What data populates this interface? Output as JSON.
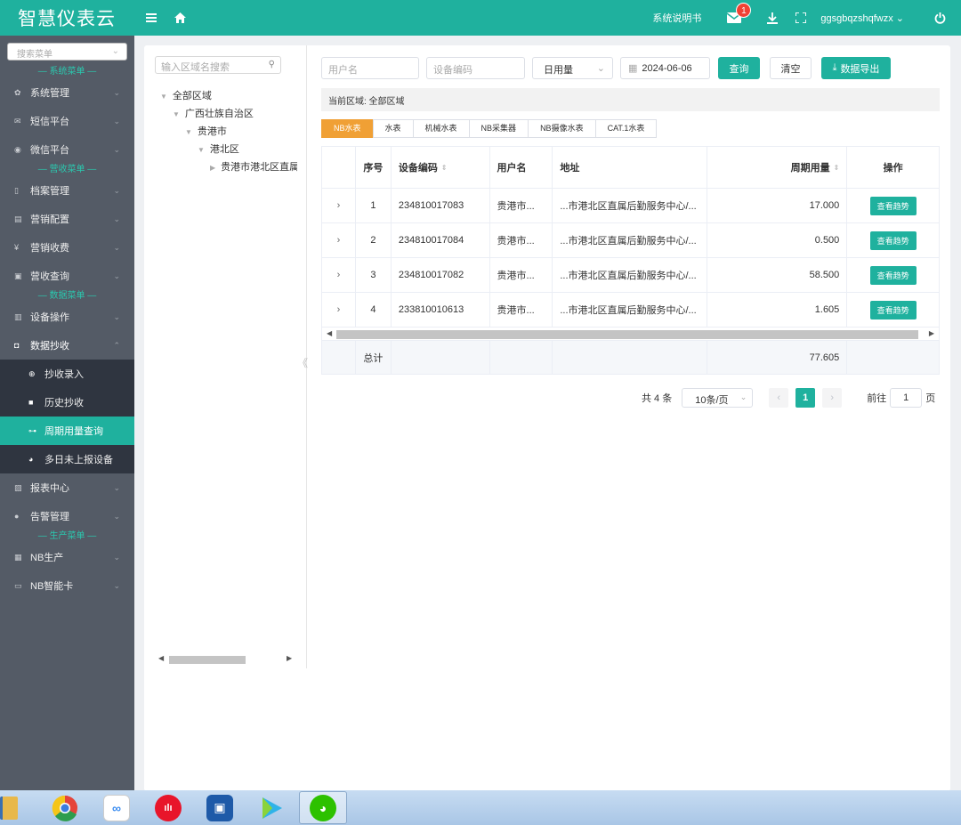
{
  "header": {
    "brand": "智慧仪表云",
    "manual": "系统说明书",
    "mail_badge": "1",
    "username": "ggsgbqzshqfwzx",
    "icons": [
      "menu-icon",
      "home-icon",
      "mail-icon",
      "download-icon",
      "fullscreen-icon",
      "power-icon"
    ]
  },
  "sidebar": {
    "search_placeholder": "搜索菜单",
    "sections": [
      "— 系统菜单 —",
      "— 营收菜单 —",
      "— 数据菜单 —",
      "— 生产菜单 —"
    ],
    "items": {
      "system": "系统管理",
      "sms": "短信平台",
      "wechat": "微信平台",
      "archive": "档案管理",
      "sales_config": "营销配置",
      "sales_fee": "营销收费",
      "revenue_query": "营收查询",
      "device_op": "设备操作",
      "meter_reading": "数据抄收",
      "reading_entry": "抄收录入",
      "history_reading": "历史抄收",
      "period_usage": "周期用量查询",
      "no_report": "多日未上报设备",
      "report": "报表中心",
      "alarm": "告警管理",
      "nb_prod": "NB生产",
      "nb_card": "NB智能卡"
    }
  },
  "tree": {
    "search_placeholder": "输入区域名搜索",
    "nodes": [
      "全部区域",
      "广西壮族自治区",
      "贵港市",
      "港北区",
      "贵港市港北区直属"
    ]
  },
  "filters": {
    "user_placeholder": "用户名",
    "device_placeholder": "设备编码",
    "usage_type": "日用量",
    "date": "2024-06-06",
    "query": "查询",
    "clear": "清空",
    "export": "数据导出"
  },
  "region_bar": "当前区域: 全部区域",
  "tabs": [
    "NB水表",
    "水表",
    "机械水表",
    "NB采集器",
    "NB摄像水表",
    "CAT.1水表"
  ],
  "table": {
    "headers": {
      "index": "序号",
      "device": "设备编码",
      "user": "用户名",
      "address": "地址",
      "usage": "周期用量",
      "action": "操作"
    },
    "rows": [
      {
        "index": "1",
        "device": "234810017083",
        "user": "贵港市...",
        "address": "...市港北区直属后勤服务中心/...",
        "usage": "17.000",
        "action": "查看趋势"
      },
      {
        "index": "2",
        "device": "234810017084",
        "user": "贵港市...",
        "address": "...市港北区直属后勤服务中心/...",
        "usage": "0.500",
        "action": "查看趋势"
      },
      {
        "index": "3",
        "device": "234810017082",
        "user": "贵港市...",
        "address": "...市港北区直属后勤服务中心/...",
        "usage": "58.500",
        "action": "查看趋势"
      },
      {
        "index": "4",
        "device": "233810010613",
        "user": "贵港市...",
        "address": "...市港北区直属后勤服务中心/...",
        "usage": "1.605",
        "action": "查看趋势"
      }
    ],
    "total_label": "总计",
    "total_value": "77.605"
  },
  "pagination": {
    "total": "共 4 条",
    "page_size": "10条/页",
    "current": "1",
    "goto_prefix": "前往",
    "goto_value": "1",
    "goto_suffix": "页"
  },
  "taskbar": {
    "apps": [
      "file-explorer-icon",
      "chrome-icon",
      "baidu-netdisk-icon",
      "app-red-icon",
      "app-blue-icon",
      "video-player-icon",
      "wechat-icon"
    ]
  },
  "colors": {
    "primary": "#1fb19e",
    "sidebar": "#545b66",
    "active_tab": "#f0a035",
    "badge": "#f04134"
  }
}
